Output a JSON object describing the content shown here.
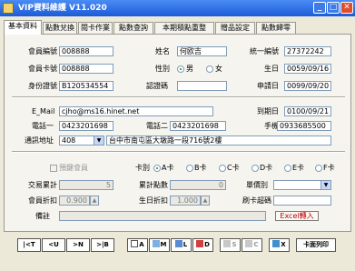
{
  "window": {
    "title": "VIP資料維護 V11.020"
  },
  "tabs": [
    "基本資料",
    "點數兌換",
    "閱卡作業",
    "點數查詢",
    "本期積點重整",
    "贈品設定",
    "點數歸零"
  ],
  "form": {
    "member_no_label": "會員編號",
    "member_no": "008888",
    "name_label": "姓名",
    "name": "何欧吉",
    "tax_id_label": "統一編號",
    "tax_id": "27372242",
    "card_no_label": "會員卡號",
    "card_no": "008888",
    "gender_label": "性別",
    "gender_male": "男",
    "gender_female": "女",
    "birthday_label": "生日",
    "birthday": "0059/09/16",
    "id_no_label": "身份證號",
    "id_no": "B120534554",
    "auth_code_label": "認證碼",
    "auth_code": "",
    "apply_date_label": "申請日",
    "apply_date": "0099/09/20",
    "email_label": "E_Mail",
    "email": "cjho@ms16.hinet.net",
    "expire_date_label": "到期日",
    "expire_date": "0100/09/21",
    "phone1_label": "電話一",
    "phone1": "0423201698",
    "phone2_label": "電話二",
    "phone2": "0423201698",
    "mobile_label": "手機",
    "mobile": "0933685500",
    "address_label": "通訊地址",
    "zip": "408",
    "address": "台中市南屯區大墩路一段716號2樓"
  },
  "cards": {
    "preview_label": "預鍵會員",
    "card_label": "卡別",
    "options": [
      "A卡",
      "B卡",
      "C卡",
      "D卡",
      "E卡",
      "F卡"
    ],
    "trade_total_label": "交易累計",
    "trade_total": "5",
    "points_total_label": "累計點數",
    "points_total": "0",
    "price_tier_label": "單價別",
    "price_tier": "",
    "discount_label": "會員折扣",
    "discount": "0.900",
    "bday_discount_label": "生日折扣",
    "bday_discount": "1.000",
    "card_recharge_label": "刷卡超碼",
    "card_recharge": "",
    "note_label": "備註",
    "note": "",
    "excel_button": "Excel轉入"
  },
  "toolbar": {
    "nav": [
      "|<T",
      "<U",
      ">N",
      ">|B"
    ],
    "actions": [
      "A",
      "M",
      "L",
      "D",
      "S",
      "C",
      "X"
    ],
    "barcode_label": "卡面列印"
  },
  "colors": {
    "titlebar": "#1c5bd6",
    "panel": "#f5f4ef",
    "excel_text": "#c00000"
  }
}
